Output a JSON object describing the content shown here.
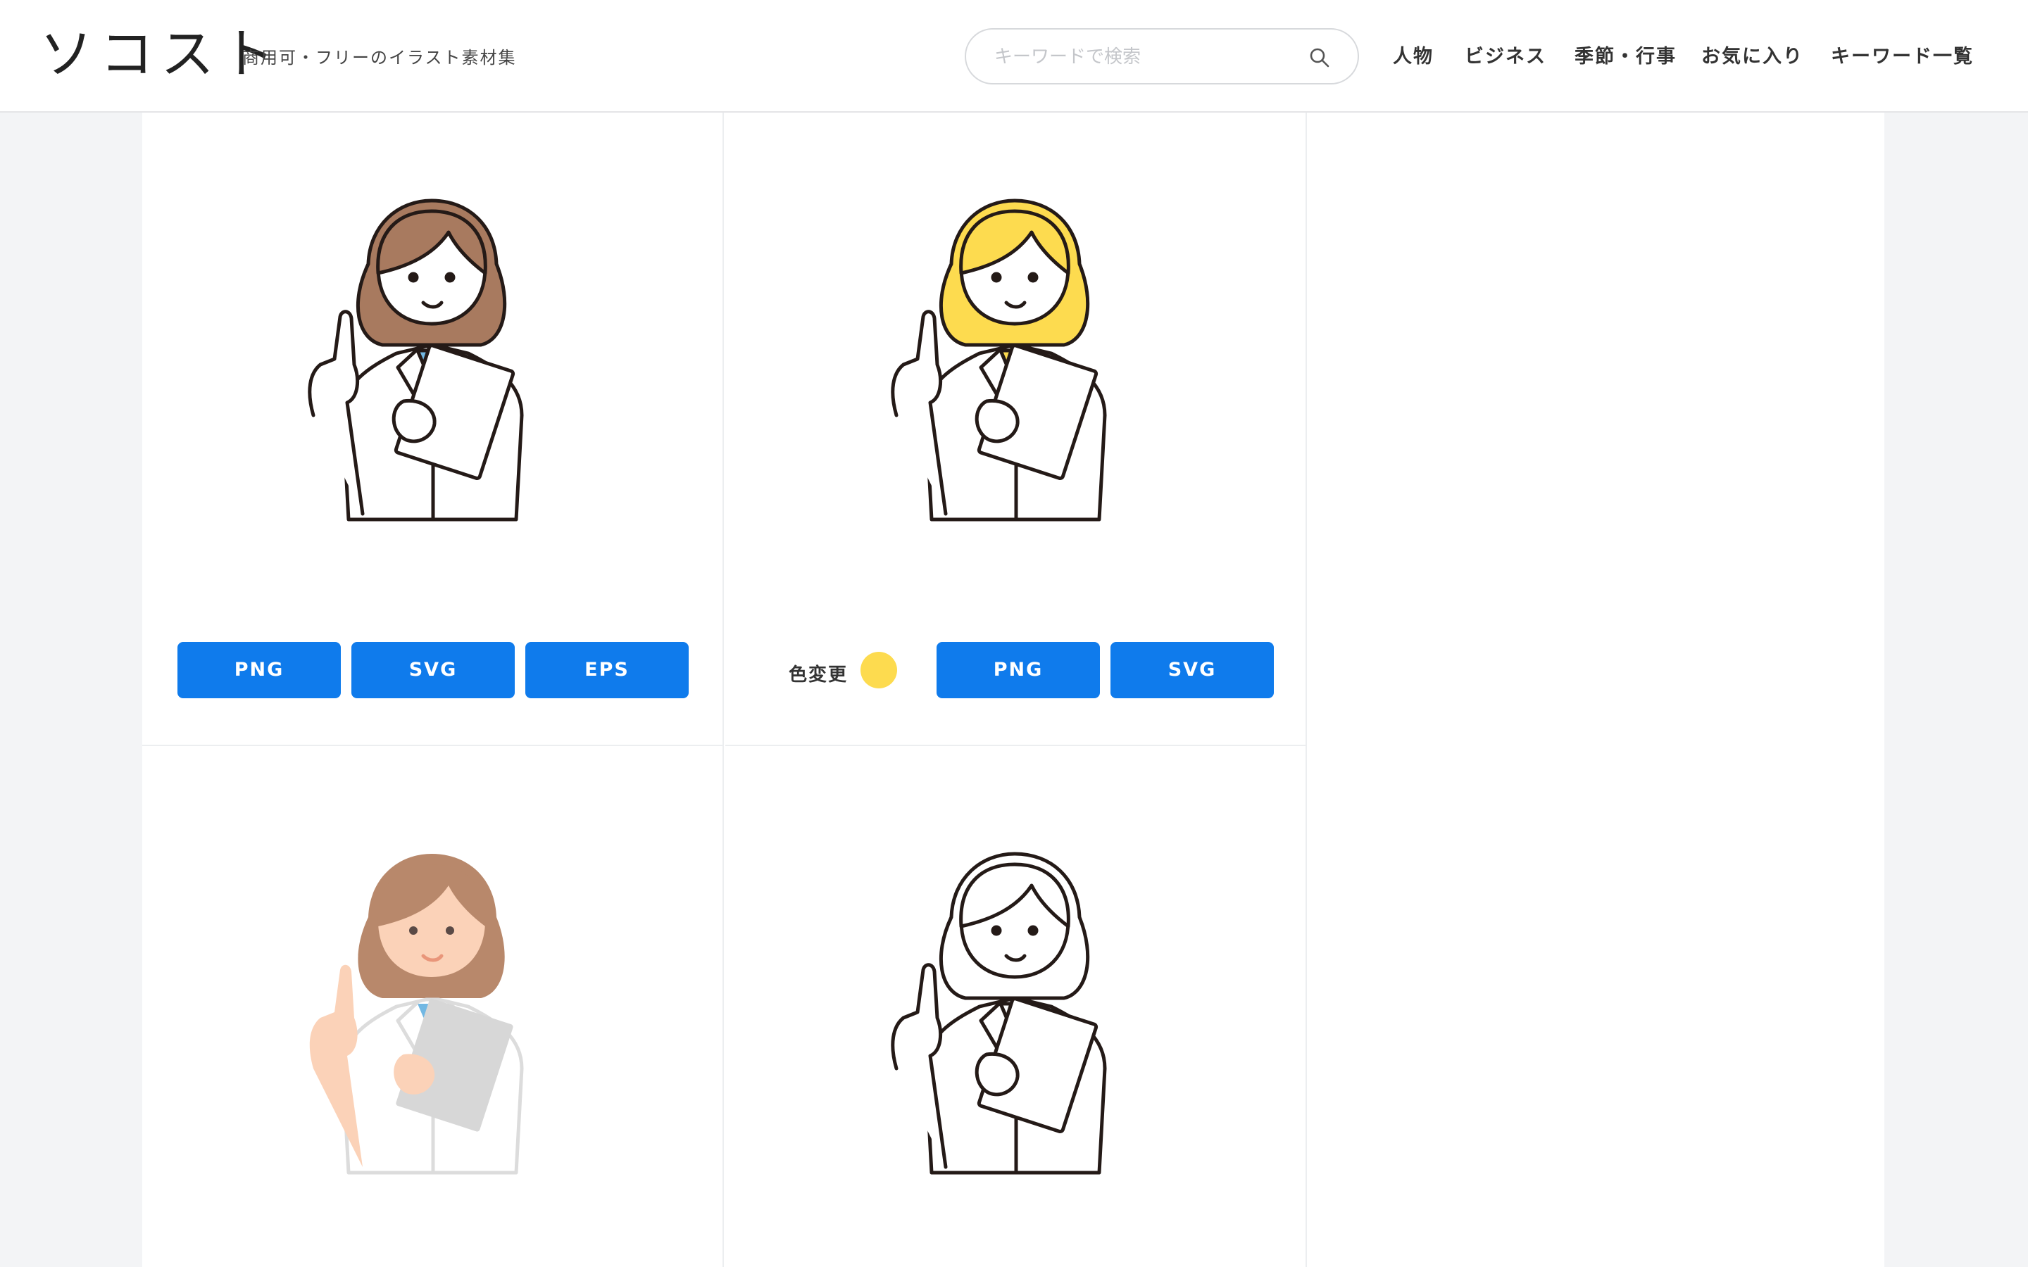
{
  "header": {
    "logo": "ソコスト",
    "tagline": "商用可・フリーのイラスト素材集",
    "search_placeholder": "キーワードで検索",
    "search_icon": "search-icon",
    "nav": [
      "人物",
      "ビジネス",
      "季節・行事",
      "お気に入り",
      "キーワード一覧"
    ]
  },
  "cards": [
    {
      "style": "line-color-brown-hair",
      "hair_color": "#a87a5f",
      "shirt_color": "#72b8e3",
      "buttons": [
        "PNG",
        "SVG",
        "EPS"
      ]
    },
    {
      "style": "line-color-yellow-hair",
      "hair_color": "#fddb4f",
      "shirt_color": "#fddb4f",
      "color_change_label": "色変更",
      "color_dot": "#fddb4f",
      "buttons": [
        "PNG",
        "SVG"
      ]
    },
    {
      "style": "flat-no-outline",
      "hair_color": "#b8886b",
      "shirt_color": "#72b8e3"
    },
    {
      "style": "line-only"
    }
  ],
  "colors": {
    "accent": "#0f7bec",
    "background": "#f3f4f6",
    "outline": "#241a17"
  }
}
